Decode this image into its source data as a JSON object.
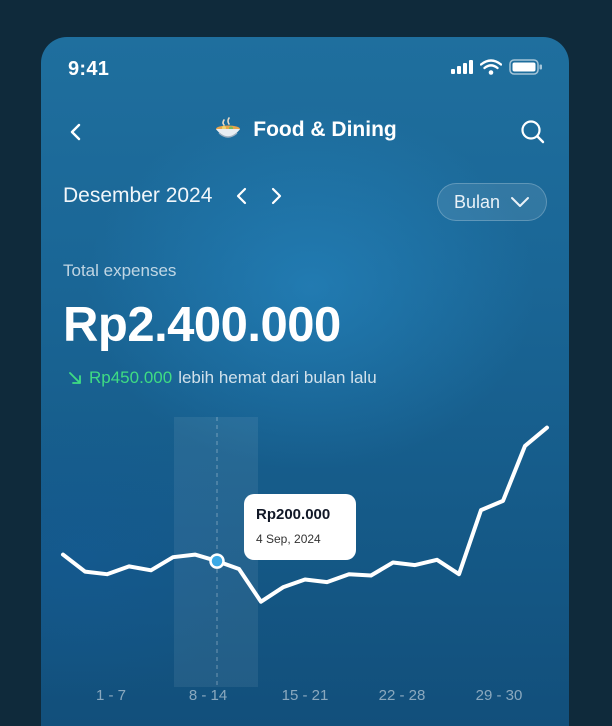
{
  "status": {
    "time": "9:41"
  },
  "header": {
    "title": "Food & Dining",
    "category_icon": "food-bowl-icon"
  },
  "period_nav": {
    "month": "Desember 2024",
    "period_selector": "Bulan"
  },
  "summary": {
    "label": "Total expenses",
    "amount": "Rp2.400.000",
    "saving_amount": "Rp450.000",
    "saving_text": "lebih hemat dari bulan lalu"
  },
  "tooltip": {
    "amount": "Rp200.000",
    "date": "4 Sep, 2024"
  },
  "chart_data": {
    "type": "line",
    "categories": [
      "1 - 7",
      "8 - 14",
      "15 - 21",
      "22 - 28",
      "29 - 30"
    ],
    "values": [
      66,
      53,
      51,
      57,
      54,
      64,
      66,
      61,
      55,
      30,
      41,
      47,
      45,
      51,
      50,
      60,
      58,
      62,
      51,
      100,
      107,
      149,
      163
    ],
    "highlight_index": 7,
    "highlight_category": "8 - 14",
    "y_note": "relative height only; no y-axis printed"
  },
  "colors": {
    "accent_green": "#3fdc83",
    "background_top": "#1f6f9e",
    "background_bottom": "#124f7b"
  }
}
